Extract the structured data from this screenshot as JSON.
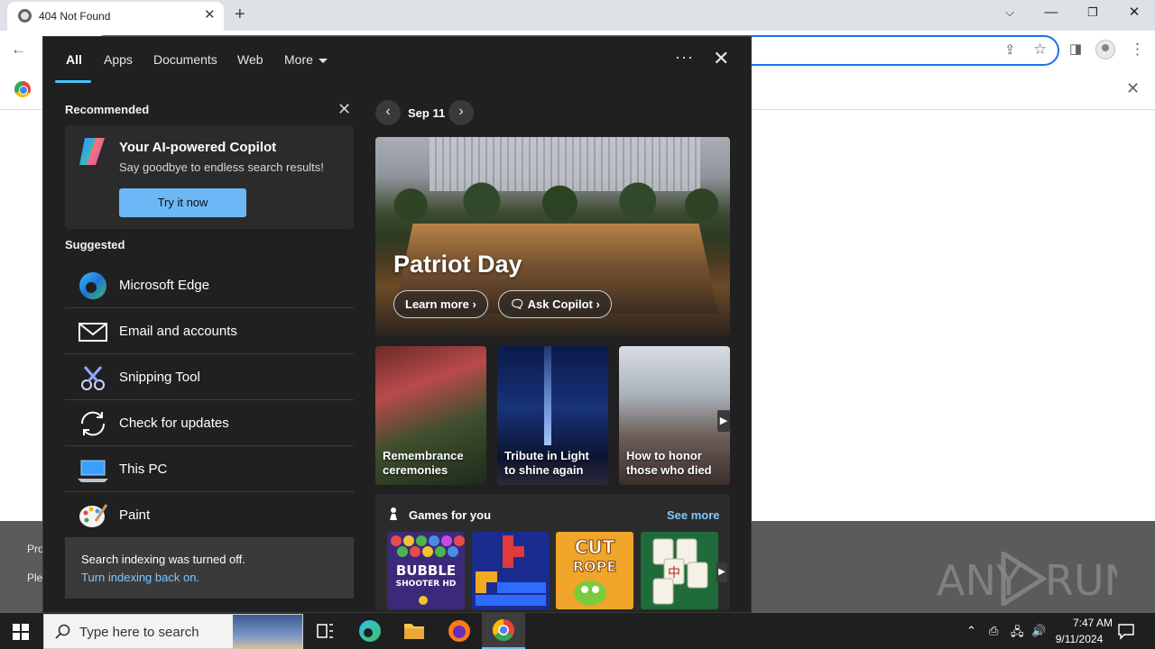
{
  "browser": {
    "tab_title": "404 Not Found",
    "new_tab_symbol": "+"
  },
  "page": {
    "bottom_line1": "Pro",
    "bottom_line2": "Ple",
    "watermark": "ANY RUN"
  },
  "search": {
    "tabs": [
      "All",
      "Apps",
      "Documents",
      "Web",
      "More"
    ],
    "active_tab": "All",
    "recommended_title": "Recommended",
    "copilot": {
      "title": "Your AI-powered Copilot",
      "subtitle": "Say goodbye to endless search results!",
      "button": "Try it now"
    },
    "suggested_title": "Suggested",
    "suggested": [
      {
        "label": "Microsoft Edge",
        "icon": "edge-icon"
      },
      {
        "label": "Email and accounts",
        "icon": "mail-icon"
      },
      {
        "label": "Snipping Tool",
        "icon": "snipping-tool-icon"
      },
      {
        "label": "Check for updates",
        "icon": "sync-icon"
      },
      {
        "label": "This PC",
        "icon": "computer-icon"
      },
      {
        "label": "Paint",
        "icon": "paint-palette-icon"
      }
    ],
    "indexing": {
      "text": "Search indexing was turned off.",
      "link": "Turn indexing back on."
    },
    "date": "Sep 11",
    "hero": {
      "title": "Patriot Day",
      "learn_more": "Learn more",
      "ask_copilot": "Ask Copilot"
    },
    "news": [
      "Remembrance ceremonies",
      "Tribute in Light to shine again",
      "How to honor those who died"
    ],
    "games": {
      "title": "Games for you",
      "see_more": "See more",
      "tiles": [
        "Bubble Shooter HD",
        "Tetris-style blocks",
        "Cut the Rope",
        "Mahjong"
      ]
    }
  },
  "taskbar": {
    "search_placeholder": "Type here to search",
    "time": "7:47 AM",
    "date": "9/11/2024"
  },
  "colors": {
    "accent": "#4cc2ff",
    "link": "#82c8ff",
    "button": "#6cb8f6",
    "flyout_bg": "#202020"
  }
}
